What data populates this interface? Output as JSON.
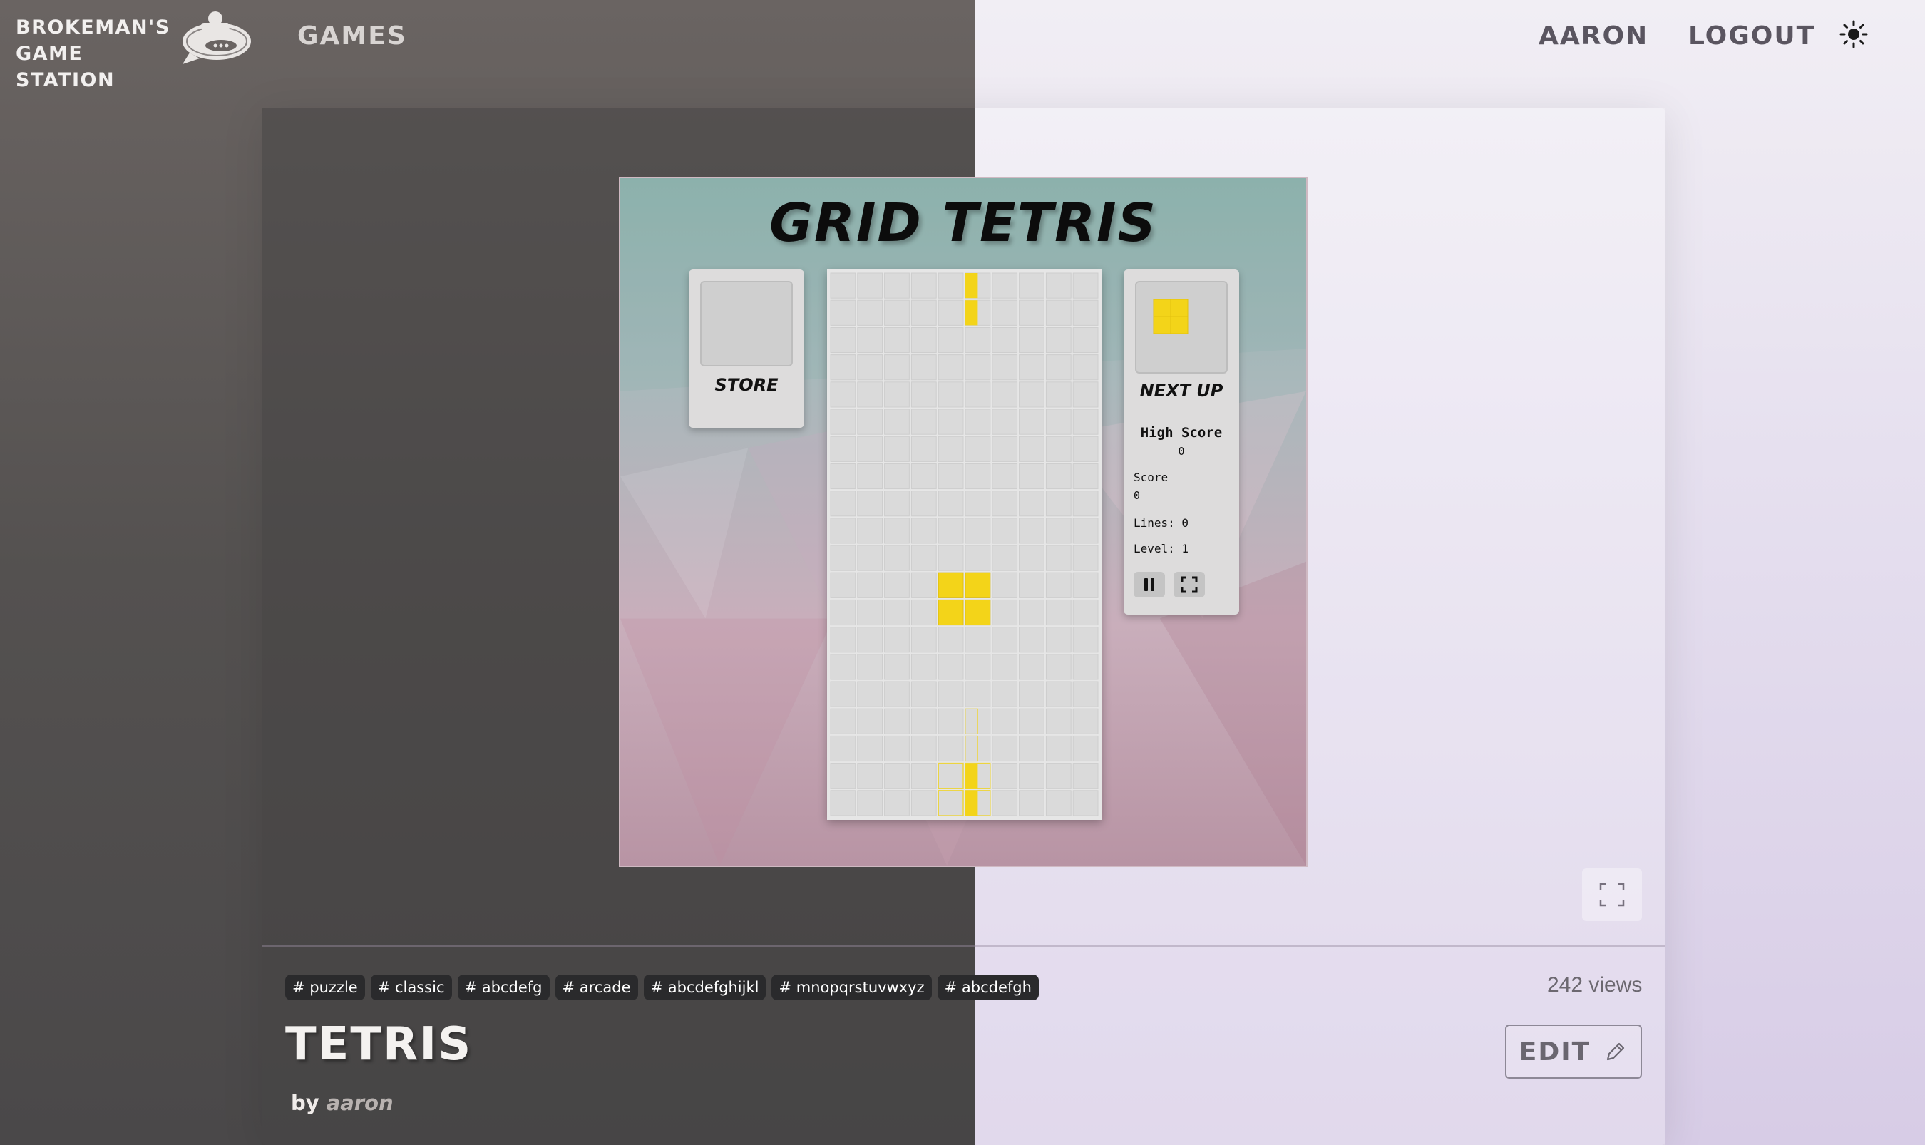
{
  "nav": {
    "brand": "BROKEMAN'S GAME STATION",
    "games": "GAMES",
    "user": "AARON",
    "logout": "LOGOUT",
    "theme_icon": "sun-icon"
  },
  "game": {
    "title": "GRID TETRIS",
    "store_label": "STORE",
    "next_label": "NEXT UP",
    "high_score_label": "High Score",
    "high_score": "0",
    "score_label": "Score",
    "score": "0",
    "lines": "Lines: 0",
    "level": "Level: 1",
    "board": {
      "columns": 10,
      "rows": 20
    },
    "piece_color": "#f3d419",
    "ghost_color": "#f3d419"
  },
  "tags": [
    "# puzzle",
    "# classic",
    "# abcdefg",
    "# arcade",
    "# abcdefghijkl",
    "# mnopqrstuvwxyz",
    "# abcdefgh"
  ],
  "views": "242 views",
  "title": "TETRIS",
  "byline": {
    "prefix": "by",
    "author": "aaron"
  },
  "edit_label": "EDIT"
}
